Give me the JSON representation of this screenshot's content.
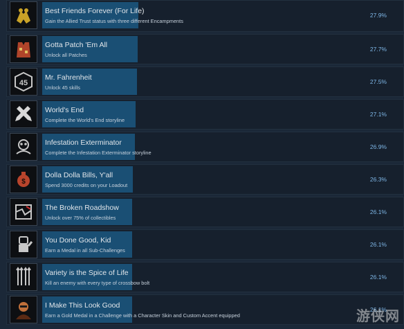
{
  "achievements": [
    {
      "title": "Best Friends Forever (For Life)",
      "description": "Gain the Allied Trust status with three different Encampments",
      "percent": "27.9%",
      "progress": 0.279,
      "icon": "clasped-hands-icon",
      "icon_color": "#c9a227"
    },
    {
      "title": "Gotta Patch 'Em All",
      "description": "Unlock all Patches",
      "percent": "27.7%",
      "progress": 0.277,
      "icon": "patch-vest-icon",
      "icon_color": "#b0442a"
    },
    {
      "title": "Mr. Fahrenheit",
      "description": "Unlock 45 skills",
      "percent": "27.5%",
      "progress": 0.275,
      "icon": "badge-45-icon",
      "icon_color": "#c8c8c8"
    },
    {
      "title": "World's End",
      "description": "Complete the World's End storyline",
      "percent": "27.1%",
      "progress": 0.271,
      "icon": "crossed-x-icon",
      "icon_color": "#d8d8d8"
    },
    {
      "title": "Infestation Exterminator",
      "description": "Complete the Infestation Exterminator storyline",
      "percent": "26.9%",
      "progress": 0.269,
      "icon": "biohazard-skull-icon",
      "icon_color": "#c8c8c8"
    },
    {
      "title": "Dolla Dolla Bills, Y'all",
      "description": "Spend 3000 credits on your Loadout",
      "percent": "26.3%",
      "progress": 0.263,
      "icon": "money-bag-icon",
      "icon_color": "#b8442c"
    },
    {
      "title": "The Broken Roadshow",
      "description": "Unlock over 75% of collectibles",
      "percent": "26.1%",
      "progress": 0.261,
      "icon": "broken-map-icon",
      "icon_color": "#c8c8c8"
    },
    {
      "title": "You Done Good, Kid",
      "description": "Earn a Medal in all Sub-Challenges",
      "percent": "26.1%",
      "progress": 0.261,
      "icon": "robot-thumbs-icon",
      "icon_color": "#c8c8c8"
    },
    {
      "title": "Variety is the Spice of Life",
      "description": "Kill an enemy with every type of crossbow bolt",
      "percent": "26.1%",
      "progress": 0.261,
      "icon": "crossbow-bolts-icon",
      "icon_color": "#c8c8c8"
    },
    {
      "title": "I Make This Look Good",
      "description": "Earn a Gold Medal in a Challenge with a Character Skin and Custom Accent equipped",
      "percent": "26.1%",
      "progress": 0.261,
      "icon": "character-portrait-icon",
      "icon_color": "#c0703a"
    }
  ],
  "watermark": "游侠网"
}
